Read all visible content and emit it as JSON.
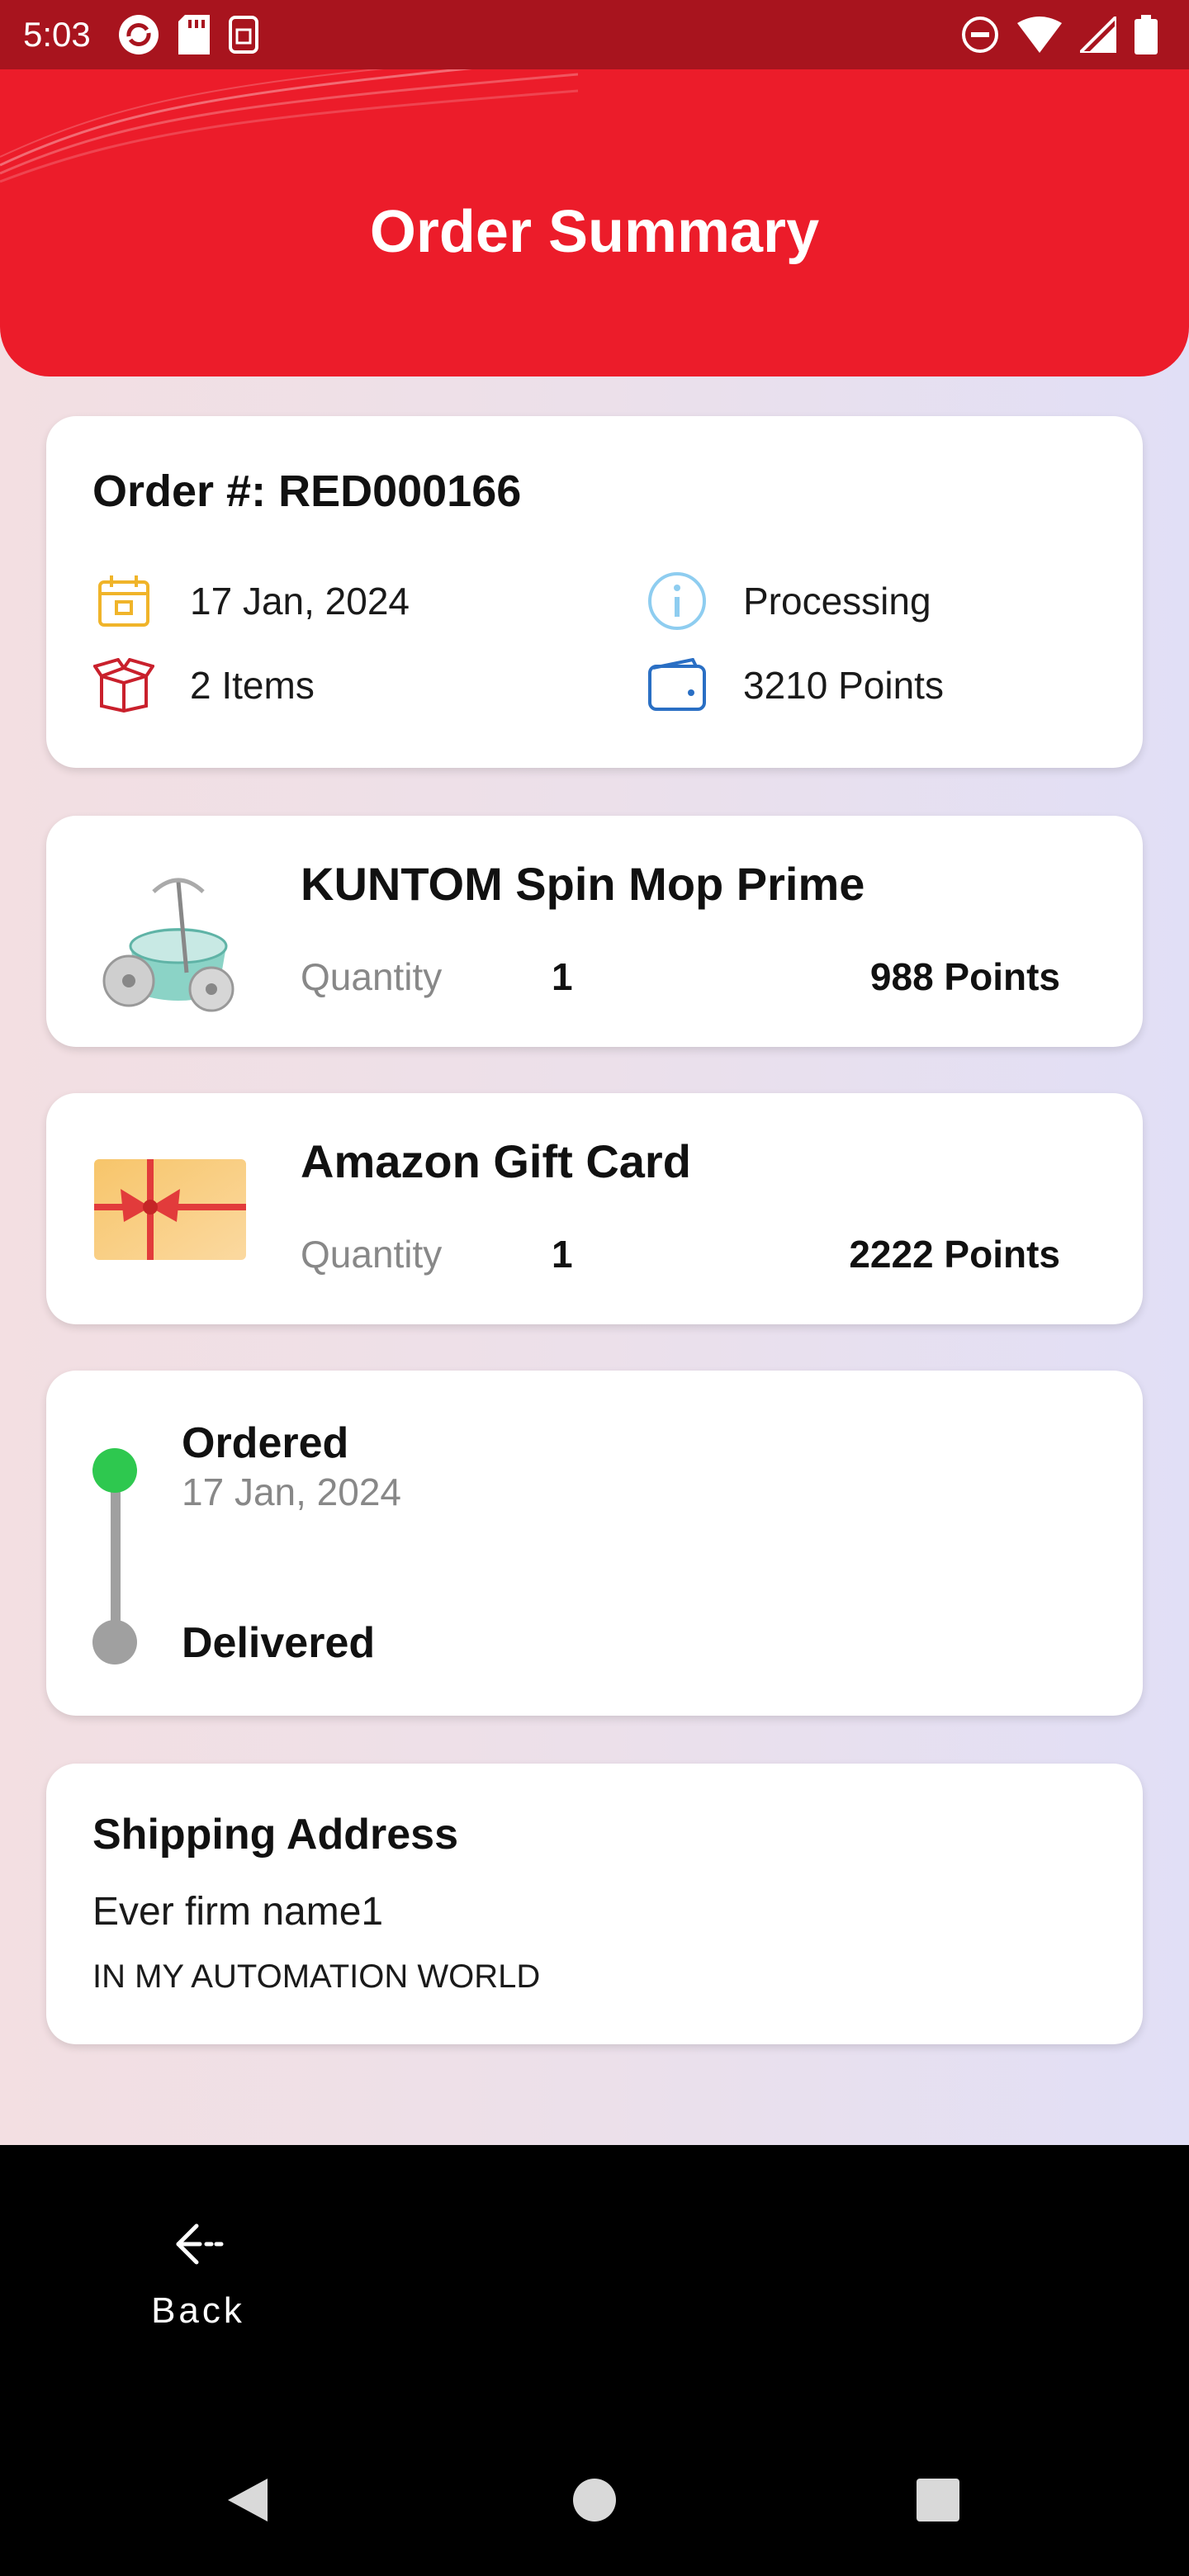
{
  "status_bar": {
    "time": "5:03"
  },
  "header": {
    "title": "Order Summary"
  },
  "order": {
    "number_label": "Order #: RED000166",
    "date": "17 Jan, 2024",
    "status": "Processing",
    "items_count": "2 Items",
    "points": "3210 Points",
    "icons": [
      "calendar-icon",
      "info-icon",
      "box-icon",
      "wallet-icon"
    ]
  },
  "items": [
    {
      "name": "KUNTOM Spin Mop Prime",
      "quantity_label": "Quantity",
      "quantity": "1",
      "points": "988 Points",
      "image": "spin-mop-image"
    },
    {
      "name": "Amazon Gift Card",
      "quantity_label": "Quantity",
      "quantity": "1",
      "points": "2222 Points",
      "image": "gift-card-image"
    }
  ],
  "tracking": {
    "ordered_label": "Ordered",
    "ordered_date": "17 Jan, 2024",
    "delivered_label": "Delivered"
  },
  "shipping": {
    "title": "Shipping Address",
    "line1": "Ever firm name1",
    "line2": "IN MY AUTOMATION WORLD"
  },
  "bottom": {
    "back_label": "Back"
  },
  "colors": {
    "accent": "#ec1c2a",
    "status_bar": "#a8141e",
    "ordered_dot": "#2ec84f",
    "pending_dot": "#a0a0a0"
  }
}
